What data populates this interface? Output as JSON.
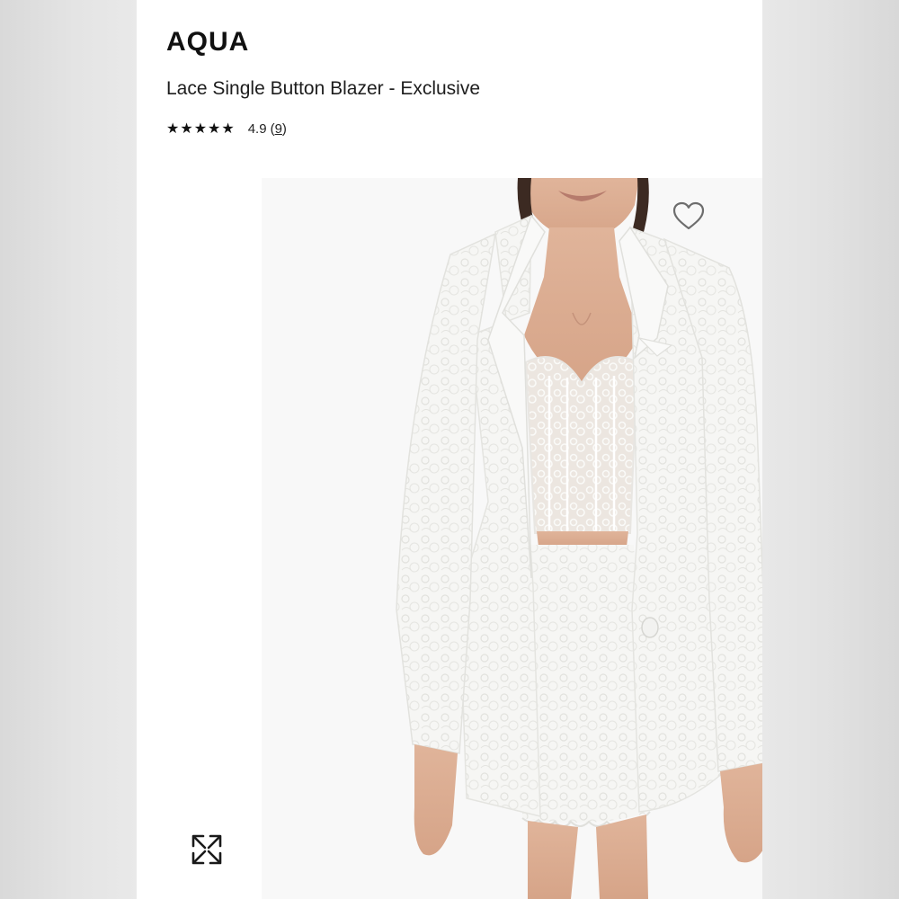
{
  "product": {
    "brand": "AQUA",
    "title": "Lace Single Button Blazer - Exclusive",
    "rating": {
      "stars": "★★★★★",
      "score": "4.9",
      "count_open": "(",
      "count": "9",
      "count_close": ")"
    }
  },
  "gallery": {
    "wishlist_icon": "heart-outline-icon",
    "expand_icon": "expand-arrows-icon"
  },
  "colors": {
    "background": "#ffffff",
    "side_panels": "#e0e0e0",
    "text": "#111111"
  }
}
